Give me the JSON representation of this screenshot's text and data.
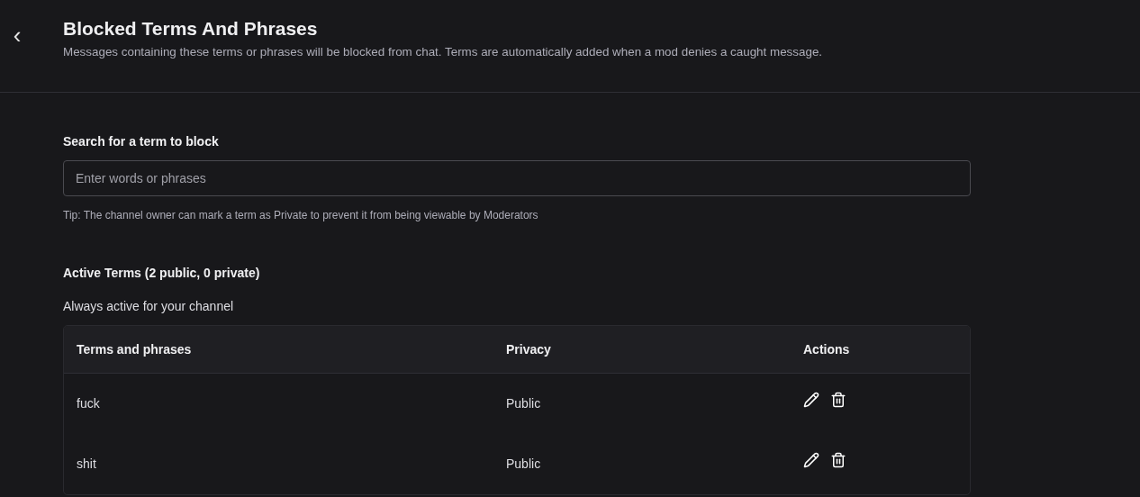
{
  "header": {
    "back": "‹",
    "title": "Blocked Terms And Phrases",
    "subtitle": "Messages containing these terms or phrases will be blocked from chat. Terms are automatically added when a mod denies a caught message."
  },
  "search": {
    "label": "Search for a term to block",
    "placeholder": "Enter words or phrases",
    "tip": "Tip: The channel owner can mark a term as Private to prevent it from being viewable by Moderators"
  },
  "active": {
    "heading": "Active Terms (2 public, 0 private)",
    "caption": "Always active for your channel"
  },
  "table": {
    "columns": [
      "Terms and phrases",
      "Privacy",
      "Actions"
    ],
    "rows": [
      {
        "term": "fuck",
        "privacy": "Public"
      },
      {
        "term": "shit",
        "privacy": "Public"
      }
    ]
  }
}
